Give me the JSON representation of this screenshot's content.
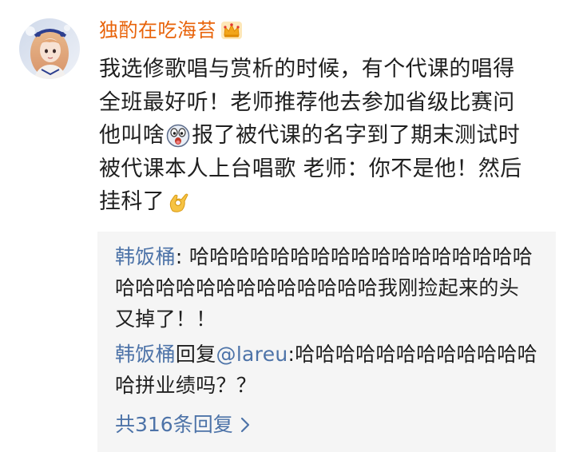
{
  "post": {
    "username": "独酌在吃海苔",
    "badge_icon": "crown-icon",
    "lines": [
      "我选修歌唱与赏析的时候，有个代课的唱得",
      "全班最好听！老师推荐他去参加省级比赛问",
      "他叫啥",
      "报了被代课的名字到了期末测试时",
      "被代课本人上台唱歌 老师：你不是他！然后",
      "挂科了"
    ],
    "emojis": [
      "shocked-face-icon",
      "ok-hand-icon"
    ]
  },
  "replies": [
    {
      "author": "韩饭桶",
      "separator": ": ",
      "line1": "哈哈哈哈哈哈哈哈哈哈哈哈哈哈哈哈哈",
      "line2": "哈哈哈哈哈哈哈哈哈哈哈哈哈我刚捡起来的头",
      "line3": "又掉了！！"
    },
    {
      "author": "韩饭桶",
      "reply_word": "回复",
      "mention": "@lareu",
      "line1_rest": ":哈哈哈哈哈哈哈哈哈哈哈哈",
      "line2": "哈拼业绩吗？？"
    }
  ],
  "more_replies": {
    "label": "共316条回复"
  },
  "colors": {
    "username": "#e8630a",
    "link": "#4d73a8",
    "text": "#1f1f1f",
    "reply_bg": "#f5f5f5"
  }
}
